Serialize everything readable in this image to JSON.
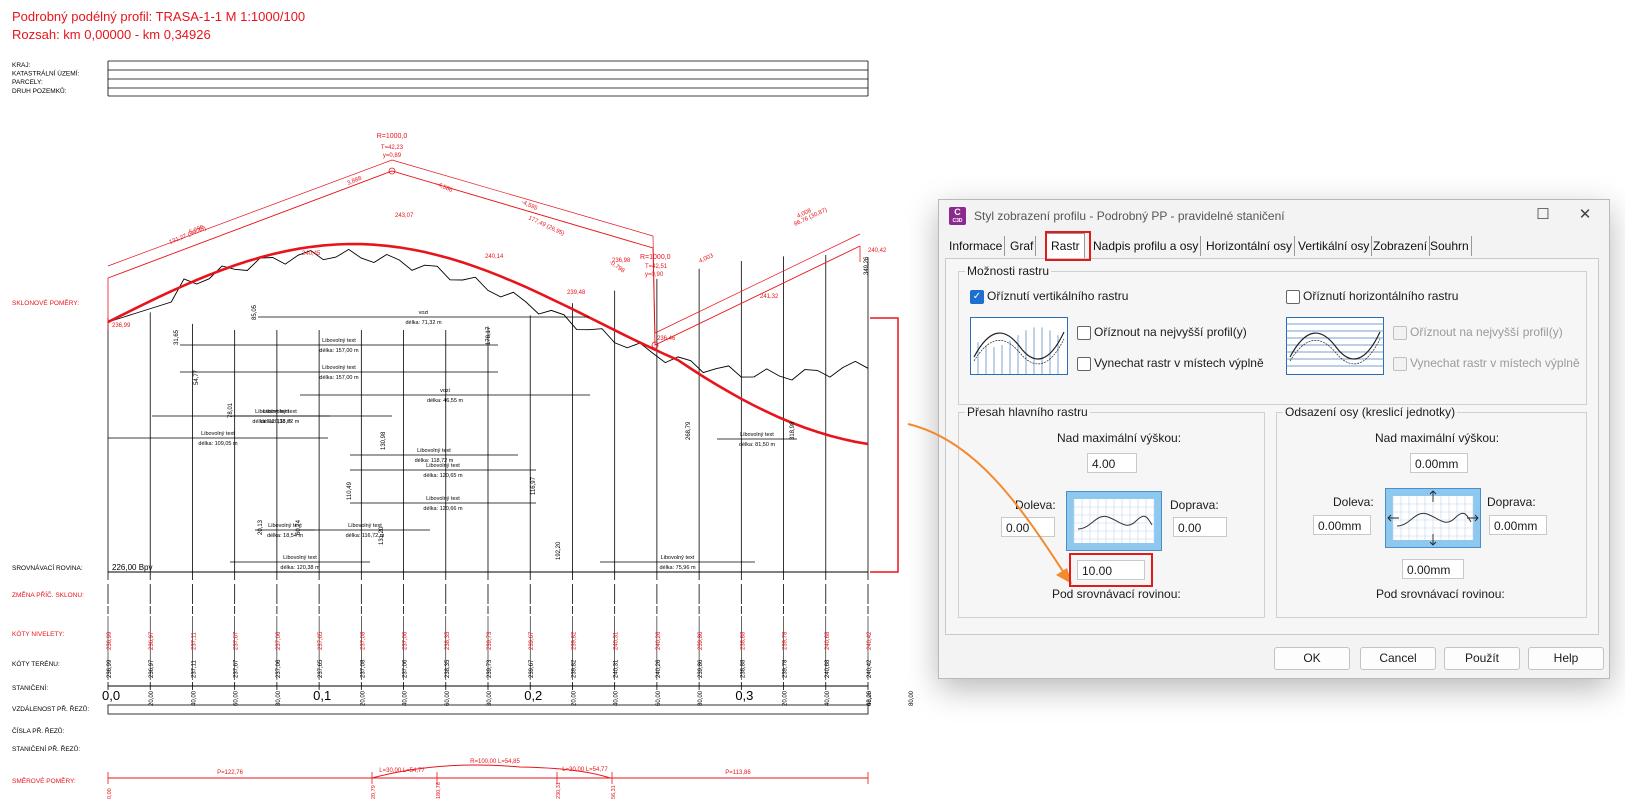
{
  "drawing": {
    "title_line1": "Podrobný podélný profil: TRASA-1-1  M 1:1000/100",
    "title_line2": "Rozsah: km 0,00000 - km 0,34926",
    "header_rows": [
      "KRAJ:",
      "KATASTRÁLNÍ ÚZEMÍ:",
      "PARCELY:",
      "DRUH POZEMKŮ:"
    ],
    "labels": {
      "sklonove_pomery": "SKLONOVÉ POMĚRY:",
      "srovnavaci_rovina": "SROVNÁVACÍ ROVINA:",
      "datum": "226,00 Bpv",
      "zmena_pric_sklonu": "ZMĚNA PŘÍČ. SKLONU:",
      "koty_nivelety": "KÓTY NIVELETY:",
      "koty_terenu": "KÓTY TERÉNU:",
      "staniceni": "STANIČENÍ:",
      "vzdalenost_pr_rezu": "VZDÁLENOST PŘ. ŘEZŮ:",
      "cisla_pr_rezu": "ČÍSLA PŘ. ŘEZŮ:",
      "staniceni_pr_rezu": "STANIČENÍ PŘ. ŘEZŮ:",
      "smerove_pomery": "SMĚROVÉ POMĚRY:"
    },
    "curves": [
      {
        "r": "R=1000,0",
        "t": "T=42,23",
        "y": "y=0,89"
      },
      {
        "r": "R=1000,0",
        "t": "T=42,51",
        "y": "y=0,90"
      }
    ],
    "chainage_major": [
      "0,0",
      "0,1",
      "0,2",
      "0,3"
    ],
    "station_labels": [
      "20,00",
      "40,00",
      "60,00",
      "80,00",
      "20,00",
      "40,00",
      "60,00",
      "80,00",
      "20,00",
      "40,00",
      "60,00",
      "80,00",
      "20,00",
      "40,00",
      "60,00",
      "80,00"
    ],
    "station_end": "48,26",
    "niveleta_values": [
      "236,99",
      "236,97",
      "237,11",
      "237,67",
      "237,06",
      "237,65",
      "237,08",
      "237,06",
      "238,35",
      "239,73",
      "239,67",
      "239,82",
      "240,31",
      "240,26",
      "239,86",
      "238,88",
      "239,78",
      "240,68",
      "240,42"
    ],
    "teren_values": [
      "236,99",
      "236,97",
      "237,11",
      "237,67",
      "237,06",
      "237,65",
      "237,08",
      "237,06",
      "238,35",
      "239,73",
      "239,67",
      "239,82",
      "240,31",
      "240,26",
      "239,86",
      "238,88",
      "239,78",
      "240,68",
      "240,42"
    ],
    "texts": [
      {
        "a": "vozi",
        "b": "délka: 46,55 m"
      },
      {
        "a": "vozi",
        "b": "délka: 71,32 m"
      },
      {
        "a": "Libovolný text",
        "b": "délka: 157,00 m"
      },
      {
        "a": "Libovolný text",
        "b": "délka: 157,00 m"
      },
      {
        "a": "Libovolný text",
        "b": "délka: 120,38 m"
      },
      {
        "a": "Libovolný text",
        "b": "délka: 118,72 m"
      },
      {
        "a": "Libovolný text",
        "b": "délka: 109,05 m"
      },
      {
        "a": "Libovolný text",
        "b": "délka: 118,72 m"
      },
      {
        "a": "Libovolný text",
        "b": "délka: 81,50 m"
      },
      {
        "a": "Libovolný text",
        "b": "délka: 120,65 m"
      },
      {
        "a": "Libovolný text",
        "b": "délka: 120,66 m"
      },
      {
        "a": "Libovolný text",
        "b": "délka: 18,54 m"
      },
      {
        "a": "Libovolný text",
        "b": "délka: 116,72 m"
      },
      {
        "a": "Libovolný text",
        "b": "délka: 120,38 m"
      },
      {
        "a": "Libovolný text",
        "b": "délka: 75,96 m"
      }
    ],
    "vert_values": [
      "31,65",
      "54,77",
      "78,01",
      "85,05",
      "110,49",
      "178,17",
      "130,98",
      "131,20",
      "116,97",
      "192,20",
      "268,79",
      "318,98",
      "349,26",
      "20,13",
      "60,74"
    ],
    "smer": [
      {
        "t": "P=122,76"
      },
      {
        "t": "L=30,00 L=54,77"
      },
      {
        "t": "R=100,00 L=54,85"
      },
      {
        "t": "L=30,00 L=54,77"
      },
      {
        "t": "P=113,86"
      }
    ],
    "smer_stations": [
      "0,00",
      "20,79",
      "180,76",
      "230,31",
      "56,31"
    ],
    "grades": [
      "5,998",
      "131,27 (59,35)",
      "3,888",
      "-4,586",
      "-4,595",
      "177,49 (26,95)",
      "-0,798",
      "4,003",
      "4,008",
      "86,76 (30,87)"
    ],
    "points": [
      "236,99",
      "240,45",
      "243,07",
      "240,14",
      "236,98",
      "240,42",
      "239,48",
      "236,46",
      "241,32"
    ]
  },
  "dialog": {
    "title": "Styl zobrazení profilu - Podrobný PP - pravidelné staničení",
    "app_icon": {
      "letter": "C",
      "sub": "C3D"
    },
    "tabs": [
      "Informace",
      "Graf",
      "Rastr",
      "Nadpis profilu a osy",
      "Horizontální osy",
      "Vertikální osy",
      "Zobrazení",
      "Souhrn"
    ],
    "active_tab": "Rastr",
    "raster_options": {
      "group_label": "Možnosti rastru",
      "clip_vertical": "Oříznutí vertikálního rastru",
      "clip_horizontal": "Oříznutí horizontálního rastru",
      "clip_highest_left": "Oříznout na nejvyšší profil(y)",
      "omit_fill_left": "Vynechat rastr v místech výplně",
      "clip_highest_right": "Oříznout na nejvyšší profil(y)",
      "omit_fill_right": "Vynechat rastr v místech výplně"
    },
    "overhang": {
      "group_label": "Přesah hlavního rastru",
      "above_label": "Nad maximální výškou:",
      "above_value": "4.00",
      "left_label": "Doleva:",
      "left_value": "0.00",
      "right_label": "Doprava:",
      "right_value": "0.00",
      "below_value": "10.00",
      "below_label": "Pod srovnávací rovinou:"
    },
    "offset": {
      "group_label": "Odsazení osy (kreslicí jednotky)",
      "above_label": "Nad maximální výškou:",
      "above_value": "0.00mm",
      "left_label": "Doleva:",
      "left_value": "0.00mm",
      "right_label": "Doprava:",
      "right_value": "0.00mm",
      "below_value": "0.00mm",
      "below_label": "Pod srovnávací rovinou:"
    },
    "buttons": {
      "ok": "OK",
      "cancel": "Cancel",
      "apply": "Použít",
      "help": "Help"
    },
    "colors": {
      "highlight": "#e01b1b",
      "arrow": "#f28a2e",
      "checkbox": "#1e6fd0",
      "drawing_red": "#e8141b"
    }
  }
}
